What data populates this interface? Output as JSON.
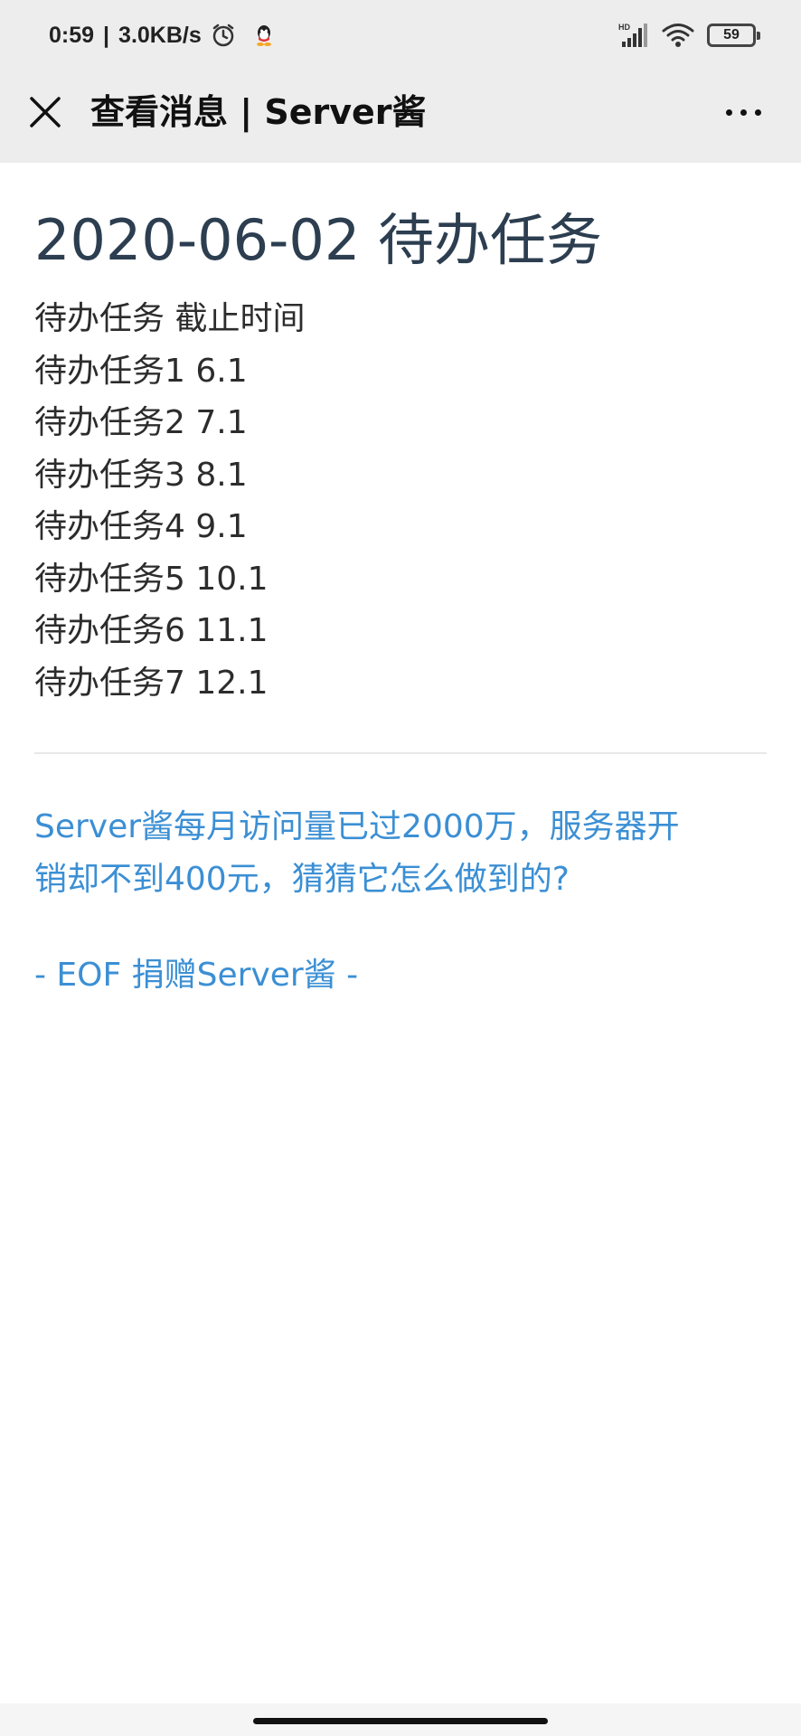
{
  "status_bar": {
    "time": "0:59",
    "separator": "|",
    "network_speed": "3.0KB/s",
    "network_type": "HD",
    "battery_level": "59",
    "icons": [
      "alarm-icon",
      "qq-icon",
      "signal-icon",
      "wifi-icon",
      "battery-icon"
    ]
  },
  "nav": {
    "title": "查看消息 | Server酱",
    "close_icon": "close-icon",
    "more_icon": "more-icon"
  },
  "message": {
    "heading": "2020-06-02 待办任务",
    "tasks": [
      "待办任务 截止时间",
      "待办任务1 6.1",
      "待办任务2 7.1",
      "待办任务3 8.1",
      "待办任务4 9.1",
      "待办任务5 10.1",
      "待办任务6 11.1",
      "待办任务7 12.1"
    ],
    "promo_line1": "Server酱每月访问量已过2000万，服务器开",
    "promo_line2": "销却不到400元，猜猜它怎么做到的?",
    "footer": "- EOF 捐赠Server酱 -"
  },
  "colors": {
    "header_bg": "#ededed",
    "heading_text": "#2c3e50",
    "link_text": "#3b8fd4"
  }
}
